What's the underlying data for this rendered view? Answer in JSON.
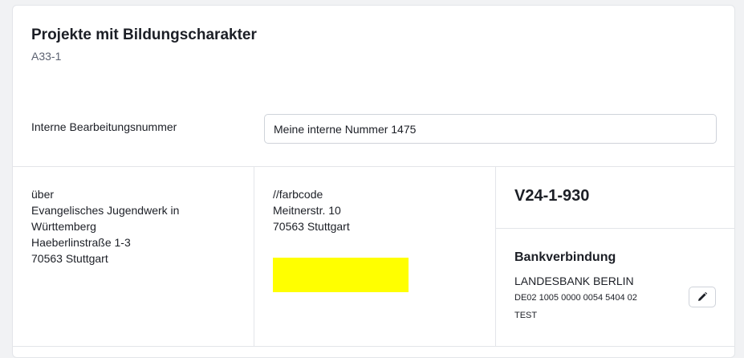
{
  "header": {
    "title": "Projekte mit Bildungscharakter",
    "code": "A33-1"
  },
  "internal_number": {
    "label": "Interne Bearbeitungsnummer",
    "value": "Meine interne Nummer 1475"
  },
  "address_1": {
    "line1": "über",
    "line2": "Evangelisches Jugendwerk in",
    "line3": "Württemberg",
    "line4": "Haeberlinstraße 1-3",
    "line5": "70563 Stuttgart"
  },
  "address_2": {
    "line1": "//farbcode",
    "line2": "Meitnerstr. 10",
    "line3": "70563 Stuttgart",
    "highlight_color": "#ffff00"
  },
  "reference": {
    "number": "V24-1-930"
  },
  "bank": {
    "title": "Bankverbindung",
    "name": "LANDESBANK BERLIN",
    "iban": "DE02 1005 0000 0054 5404 02",
    "holder": "TEST",
    "edit_icon": "pencil-icon"
  }
}
